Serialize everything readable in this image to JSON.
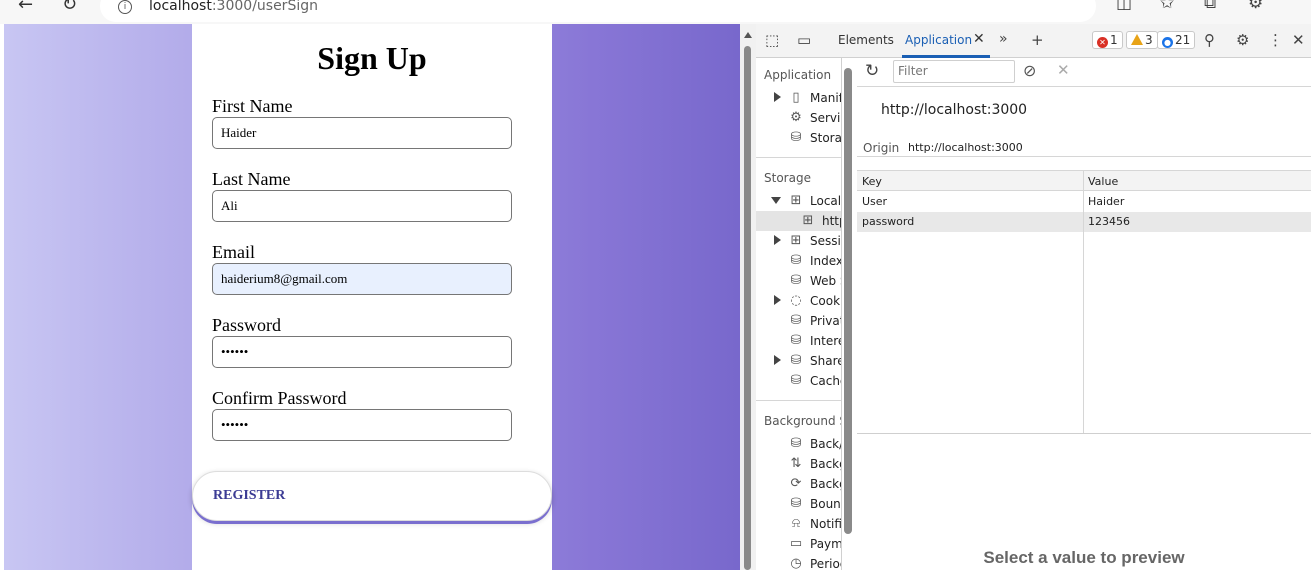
{
  "browser": {
    "url_host": "localhost",
    "url_path": ":3000/userSign"
  },
  "form": {
    "title": "Sign Up",
    "fields": [
      {
        "label": "First Name",
        "value": "Haider"
      },
      {
        "label": "Last Name",
        "value": "Ali"
      },
      {
        "label": "Email",
        "value": "haiderium8@gmail.com"
      },
      {
        "label": "Password",
        "value": "••••••"
      },
      {
        "label": "Confirm Password",
        "value": "••••••"
      }
    ],
    "register_label": "REGISTER"
  },
  "devtools": {
    "tabs": {
      "elements": "Elements",
      "application": "Application"
    },
    "badges": {
      "errors": "1",
      "warnings": "3",
      "messages": "21"
    },
    "sidebar": {
      "application_section": "Application",
      "application_items": [
        "Manif",
        "Servic",
        "Storag"
      ],
      "storage_section": "Storage",
      "storage_items": [
        "Local",
        "http",
        "Sessic",
        "Indexe",
        "Web S",
        "Cooki",
        "Privat",
        "Intere",
        "Sharec",
        "Cache"
      ],
      "background_section": "Background Se",
      "background_items": [
        "Back/",
        "Backg",
        "Backg",
        "Bounc",
        "Notifi",
        "Payme",
        "Perioc"
      ]
    },
    "storage": {
      "filter_placeholder": "Filter",
      "origin_header": "http://localhost:3000",
      "origin_label": "Origin",
      "origin_value": "http://localhost:3000",
      "columns": [
        "Key",
        "Value"
      ],
      "rows": [
        {
          "key": "User",
          "value": "Haider"
        },
        {
          "key": "password",
          "value": "123456"
        }
      ],
      "preview_text": "Select a value to preview"
    },
    "colors": {
      "accent": "#1a5fb4",
      "error": "#d93025",
      "warning": "#e8a317",
      "info": "#1a73e8"
    }
  }
}
